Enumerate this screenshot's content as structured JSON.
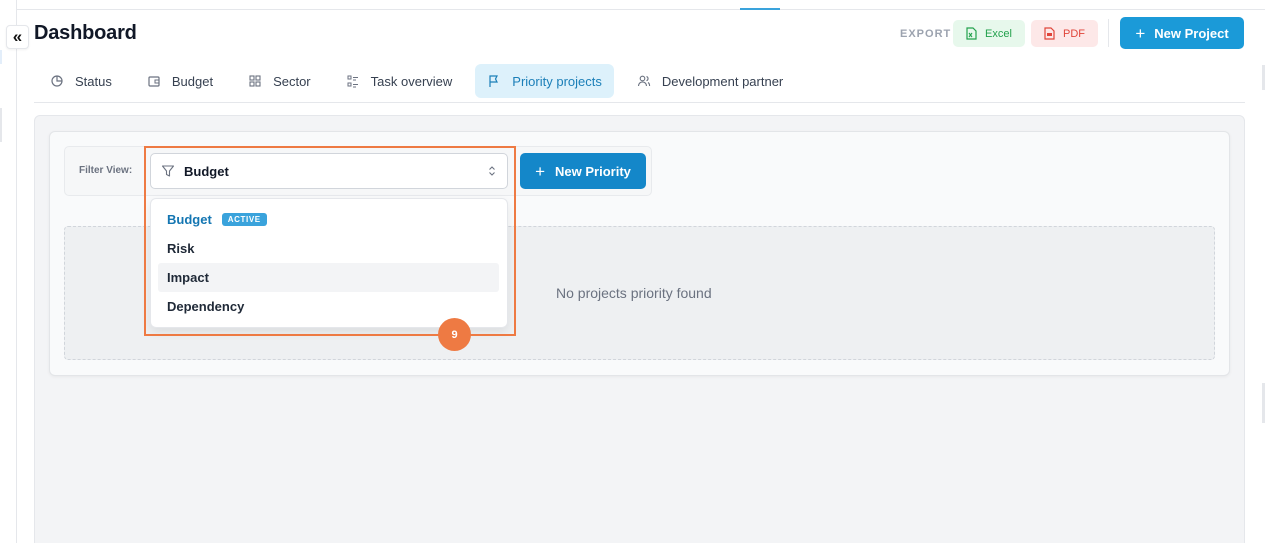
{
  "header": {
    "title": "Dashboard",
    "collapse_icon": "«",
    "export_label": "EXPORT",
    "excel_label": "Excel",
    "pdf_label": "PDF",
    "new_project_label": "New Project"
  },
  "tabs": [
    {
      "label": "Status",
      "icon": "pie-chart-icon"
    },
    {
      "label": "Budget",
      "icon": "wallet-icon"
    },
    {
      "label": "Sector",
      "icon": "grid-icon"
    },
    {
      "label": "Task overview",
      "icon": "list-icon"
    },
    {
      "label": "Priority projects",
      "icon": "flag-icon",
      "active": true
    },
    {
      "label": "Development partner",
      "icon": "users-icon"
    }
  ],
  "filter": {
    "label": "Filter View:",
    "selected": "Budget",
    "new_priority_label": "New Priority",
    "options": [
      {
        "label": "Budget",
        "badge": "ACTIVE",
        "selected": true
      },
      {
        "label": "Risk"
      },
      {
        "label": "Impact",
        "hovered": true
      },
      {
        "label": "Dependency"
      }
    ]
  },
  "empty_state": "No projects priority found",
  "annotation": {
    "marker": "9"
  },
  "colors": {
    "primary": "#1b9ad8",
    "highlight": "#ee7a43",
    "excel": "#22a14c",
    "pdf": "#e0453a"
  }
}
